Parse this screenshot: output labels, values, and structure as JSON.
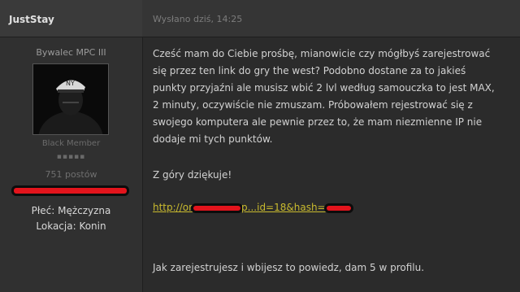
{
  "post": {
    "author": "JustStay",
    "date": "Wysłano dziś, 14:25",
    "rank_title": "Bywalec MPC III",
    "member_group": "Black Member",
    "rank_pips": "▪▪▪▪▪",
    "post_count": "751 postów",
    "gender": "Płeć: Mężczyzna",
    "location": "Lokacja: Konin",
    "body": "Cześć mam do Ciebie prośbę, mianowicie czy mógłbyś zarejestrować się przez ten link do gry the west? Podobno dostane za to jakieś punkty przyjaźni ale musisz wbić 2 lvl według samouczka to jest MAX, 2 minuty, oczywiście nie zmuszam. Próbowałem rejestrować się z swojego komputera ale pewnie przez to, że mam niezmienne IP nie dodaje mi tych punktów.",
    "thanks": "Z góry dziękuje!",
    "link_start": "http://or",
    "link_middle": "p...id=18&hash=",
    "footer": "Jak zarejestrujesz i wbijesz to powiedz, dam 5 w profilu."
  },
  "colors": {
    "background": "#2b2b2b",
    "link": "#c9ba2e",
    "redaction": "#e3141c"
  },
  "icons": {
    "avatar": "avatar-image"
  }
}
